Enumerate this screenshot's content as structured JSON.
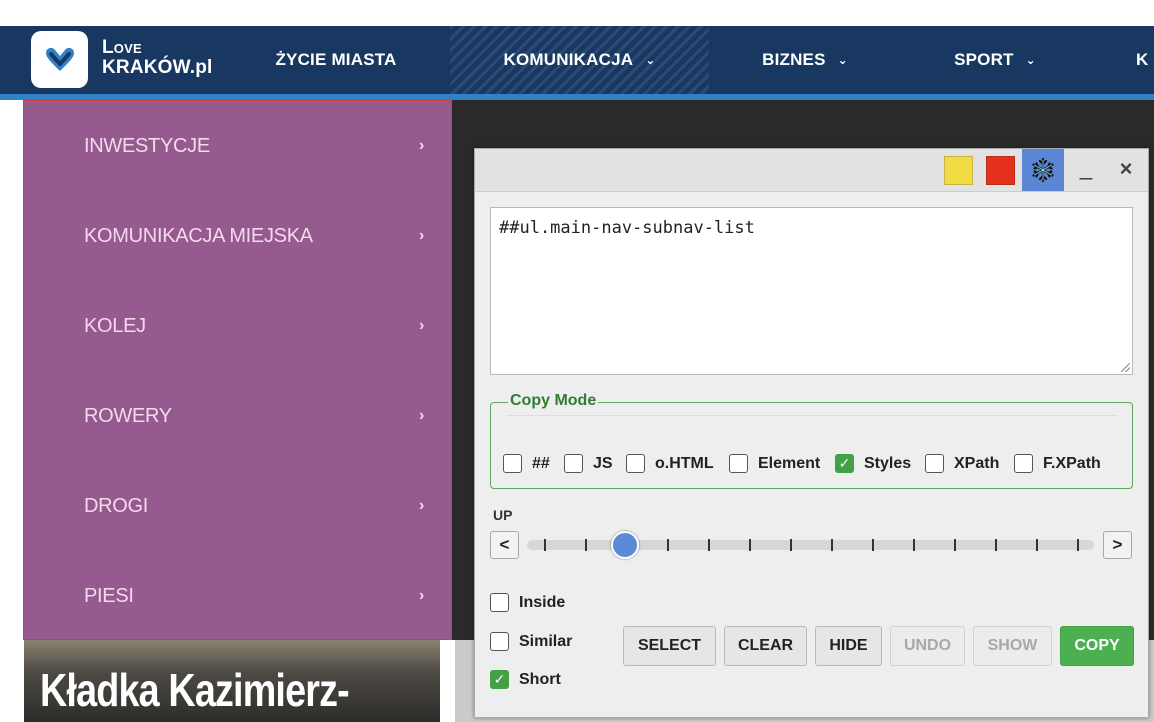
{
  "nav": {
    "logo_line1": "Love",
    "logo_line2": "KRAKÓW.pl",
    "items": [
      {
        "label": "ŻYCIE MIASTA"
      },
      {
        "label": "KOMUNIKACJA",
        "chevron": "⌄"
      },
      {
        "label": "BIZNES",
        "chevron": "⌄"
      },
      {
        "label": "SPORT",
        "chevron": "⌄"
      },
      {
        "label": "K"
      }
    ]
  },
  "submenu": {
    "items": [
      {
        "label": "INWESTYCJE",
        "arrow": "›"
      },
      {
        "label": "KOMUNIKACJA MIEJSKA",
        "arrow": "›"
      },
      {
        "label": "KOLEJ",
        "arrow": "›"
      },
      {
        "label": "ROWERY",
        "arrow": "›"
      },
      {
        "label": "DROGI",
        "arrow": "›"
      },
      {
        "label": "PIESI",
        "arrow": "›"
      }
    ]
  },
  "article": {
    "headline": "Kładka Kazimierz-"
  },
  "panel": {
    "minimize": "_",
    "close": "×",
    "selector_value": "##ul.main-nav-subnav-list",
    "copy_mode": {
      "legend": "Copy Mode",
      "options": [
        {
          "label": "##",
          "checked": false
        },
        {
          "label": "JS",
          "checked": false
        },
        {
          "label": "o.HTML",
          "checked": false
        },
        {
          "label": "Element",
          "checked": false
        },
        {
          "label": "Styles",
          "checked": true
        },
        {
          "label": "XPath",
          "checked": false
        },
        {
          "label": "F.XPath",
          "checked": false
        }
      ]
    },
    "up_label": "UP",
    "prev": "<",
    "next": ">",
    "slider": {
      "position": 3,
      "ticks": 14
    },
    "inside_label": "Inside",
    "inside_checked": false,
    "similar_label": "Similar",
    "similar_checked": false,
    "short_label": "Short",
    "short_checked": true,
    "buttons": {
      "select": "SELECT",
      "clear": "CLEAR",
      "hide": "HIDE",
      "undo": "UNDO",
      "show": "SHOW",
      "copy": "COPY"
    }
  },
  "colors": {
    "nav_bg": "#193861",
    "submenu_bg": "#955b8f",
    "submenu_text": "#f6d8ec",
    "accent_green": "#4caf50"
  }
}
